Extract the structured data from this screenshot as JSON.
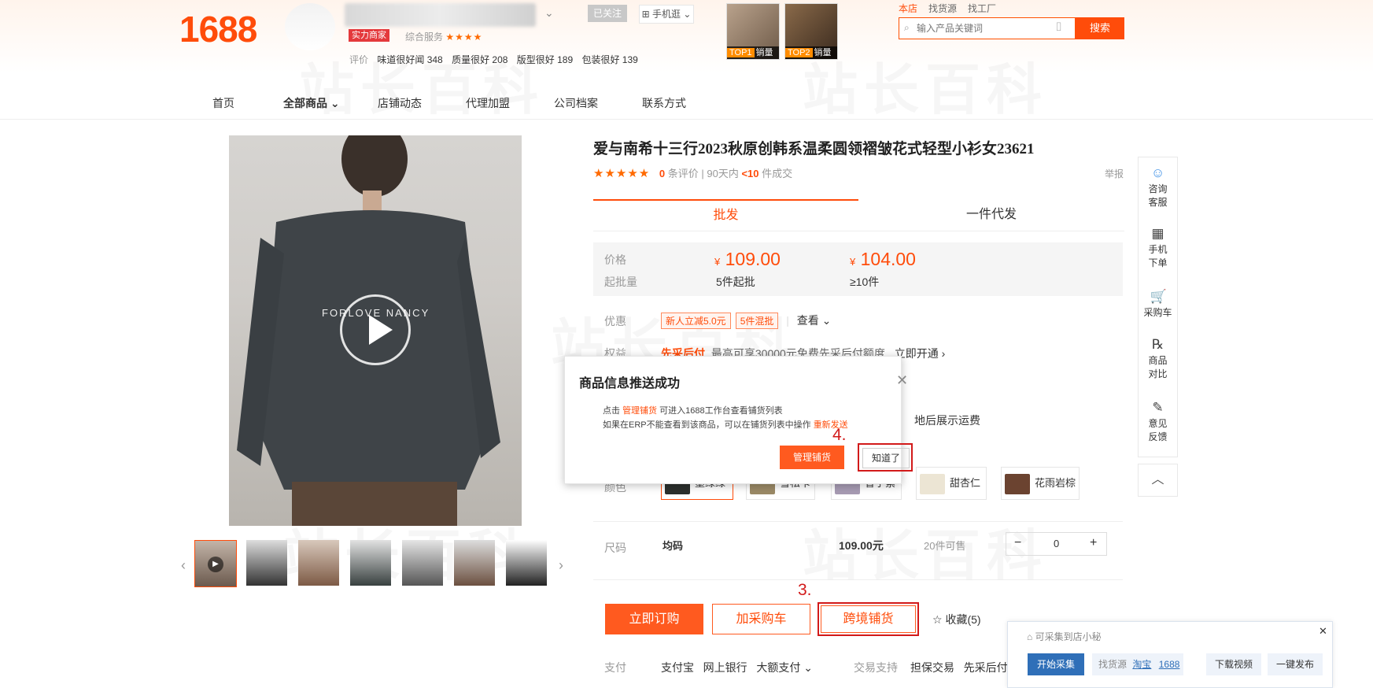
{
  "header": {
    "logo": "1688",
    "follow_label": "已关注",
    "mobile_label": "⊞ 手机逛 ⌄",
    "badge": "实力商家",
    "service_label": "综合服务",
    "service_stars": "★★★★",
    "review_label": "评价",
    "review_tags": [
      "味道很好闻 348",
      "质量很好 208",
      "版型很好 189",
      "包装很好 139"
    ],
    "top_items": [
      {
        "rank": "TOP1",
        "label": "销量"
      },
      {
        "rank": "TOP2",
        "label": "销量"
      }
    ],
    "search_tabs": [
      "本店",
      "找货源",
      "找工厂"
    ],
    "search_placeholder": "输入产品关键词",
    "search_button": "搜索"
  },
  "nav": {
    "items": [
      "首页",
      "全部商品 ⌄",
      "店铺动态",
      "代理加盟",
      "公司档案",
      "联系方式"
    ]
  },
  "product": {
    "title": "爱与南希十三行2023秋原创韩系温柔圆领褶皱花式轻型小衫女23621",
    "stars": "★★★★★",
    "review_count": "0",
    "review_unit": "条评价",
    "sold_prefix": "90天内",
    "sold_value": "<10",
    "sold_unit": "件成交",
    "report": "举报",
    "tabs": [
      "批发",
      "一件代发"
    ],
    "price_label": "价格",
    "moq_label": "起批量",
    "tiers": [
      {
        "currency": "¥",
        "price": "109.00",
        "moq": "5件起批"
      },
      {
        "currency": "¥",
        "price": "104.00",
        "moq": "≥10件"
      }
    ],
    "promo_label": "优惠",
    "coupons": [
      "新人立减5.0元",
      "5件混批"
    ],
    "promo_more": "查看 ⌄",
    "rights_label": "权益",
    "rights_highlight": "先采后付",
    "rights_text": "最高可享30000元免费先采后付额度",
    "rights_link": "立即开通 ›",
    "shipping_tail": "地后展示运费",
    "color_label": "颜色",
    "colors": [
      {
        "name": "墨绿绿",
        "hex": "#2c302d"
      },
      {
        "name": "雪松卡",
        "hex": "#9b8a66"
      },
      {
        "name": "香芋紫",
        "hex": "#a79bb3"
      },
      {
        "name": "甜杏仁",
        "hex": "#ece5d4"
      },
      {
        "name": "花雨岩棕",
        "hex": "#6b4330"
      }
    ],
    "size_label": "尺码",
    "size_value": "均码",
    "size_price": "109.00元",
    "size_stock": "20件可售",
    "qty_minus": "−",
    "qty_value": "0",
    "qty_plus": "+",
    "buy_now": "立即订购",
    "add_cart": "加采购车",
    "cross_border": "跨境铺货",
    "favorite": "☆ 收藏(5)",
    "step3": "3.",
    "step4": "4.",
    "pay_label": "支付",
    "pay_methods": [
      "支付宝",
      "网上银行",
      "大额支付 ⌄"
    ],
    "trade_label": "交易支持",
    "trade_items": [
      "担保交易",
      "先采后付"
    ]
  },
  "video_text": "FORLOVE NANCY",
  "sidebar": [
    {
      "icon": "☺",
      "label": "咨询客服"
    },
    {
      "icon": "▦",
      "label": "手机下单"
    },
    {
      "icon": "🛒",
      "label": "采购车"
    },
    {
      "icon": "℞",
      "label": "商品对比"
    },
    {
      "icon": "✎",
      "label": "意见反馈"
    }
  ],
  "sidebar_top": "︿",
  "dialog": {
    "title": "商品信息推送成功",
    "close": "✕",
    "line1_pre": "点击",
    "line1_link": "管理铺货",
    "line1_post": "可进入1688工作台查看铺货列表",
    "line2_pre": "如果在ERP不能查看到该商品，可以在铺货列表中操作",
    "line2_link": "重新发送",
    "manage_button": "管理铺货",
    "ok_button": "知道了"
  },
  "plugin": {
    "title": "可采集到店小秘",
    "close": "✕",
    "start": "开始采集",
    "find_label": "找货源",
    "taobao": "淘宝",
    "alibaba": "1688",
    "download": "下载视频",
    "publish": "一键发布"
  },
  "watermark": "站长百科",
  "colors": {
    "accent": "#ff4c0a",
    "step_red": "#d21a1a"
  }
}
